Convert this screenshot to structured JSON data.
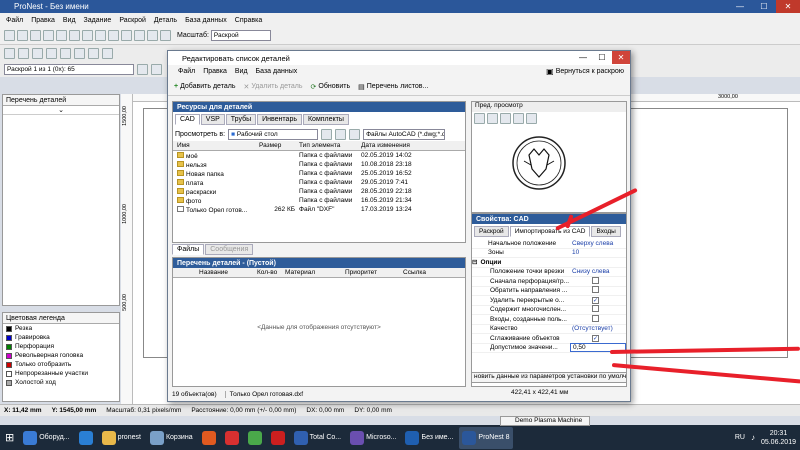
{
  "app": {
    "title": "ProNest - Без имени",
    "menu": [
      "Файл",
      "Правка",
      "Вид",
      "Задание",
      "Раскрой",
      "Деталь",
      "База данных",
      "Справка"
    ],
    "zoom_label": "Масштаб:",
    "zoom_value": "Раскрой",
    "nest_selector": "Раскрой 1 из 1 (0x): 65"
  },
  "left_panel": {
    "title": "Перечень деталей",
    "legend_title": "Цветовая легенда",
    "legend": [
      {
        "label": "Резка",
        "color": "#000000"
      },
      {
        "label": "Гравировка",
        "color": "#0000cc"
      },
      {
        "label": "Перфорация",
        "color": "#008000"
      },
      {
        "label": "Револьверная головка",
        "color": "#cc00cc"
      },
      {
        "label": "Только отобразить",
        "color": "#cc0000"
      },
      {
        "label": "Непрорезанные участки",
        "color": "#ffffff"
      },
      {
        "label": "Холостой ход",
        "color": "#aaaaaa"
      }
    ]
  },
  "rulers": {
    "v1": "1500,00",
    "v2": "1000,00",
    "v3": "500,00",
    "h": "3000,00"
  },
  "dialog": {
    "title": "Редактировать список деталей",
    "menu": [
      "Файл",
      "Правка",
      "Вид",
      "База данных"
    ],
    "return_label": "Вернуться к раскрою",
    "tools": {
      "add": "Добавить деталь",
      "delete": "Удалить деталь",
      "refresh": "Обновить",
      "sheets": "Перечень листов..."
    },
    "resources_title": "Ресурсы для деталей",
    "resource_tabs": [
      "CAD",
      "VSP",
      "Трубы",
      "Инвентарь",
      "Комплекты"
    ],
    "browse_label": "Просмотреть в:",
    "browse_value": "Рабочий стол",
    "filter_value": "Файлы AutoCAD (*.dwg;*.d",
    "file_cols": [
      "Имя",
      "Размер",
      "Тип элемента",
      "Дата изменения"
    ],
    "files": [
      {
        "name": "моё",
        "size": "",
        "type": "Папка с файлами",
        "date": "02.05.2019 14:02",
        "folder": true
      },
      {
        "name": "нельзя",
        "size": "",
        "type": "Папка с файлами",
        "date": "10.08.2018 23:18",
        "folder": true
      },
      {
        "name": "Новая папка",
        "size": "",
        "type": "Папка с файлами",
        "date": "25.05.2019 16:52",
        "folder": true
      },
      {
        "name": "плата",
        "size": "",
        "type": "Папка с файлами",
        "date": "29.05.2019 7:41",
        "folder": true
      },
      {
        "name": "раскраски",
        "size": "",
        "type": "Папка с файлами",
        "date": "28.05.2019 22:18",
        "folder": true
      },
      {
        "name": "фото",
        "size": "",
        "type": "Папка с файлами",
        "date": "16.05.2019 21:34",
        "folder": true
      },
      {
        "name": "Только Орел  готов...",
        "size": "262 КБ",
        "type": "Файл \"DXF\"",
        "date": "17.03.2019 13:24",
        "folder": false
      }
    ],
    "bottom_tabs": [
      "Файлы",
      "Сообщения"
    ],
    "parts_title": "Перечень деталей  -  (Пустой)",
    "parts_cols": [
      "Название",
      "Кол-во",
      "Материал",
      "Приоритет",
      "Ссылка"
    ],
    "parts_empty": "<Данные для отображения отсутствуют>",
    "status_count": "19 объекта(ов)",
    "status_file": "Только Орел готовая.dxf",
    "status_size": "422,41 x 422,41 мм",
    "preview_title": "Пред. просмотр",
    "props_title": "Свойства: CAD",
    "props_tabs": [
      "Раскрой",
      "Импортировать из CAD",
      "Входы"
    ],
    "props": [
      {
        "name": "Начальное положение",
        "value": "Сверху слева",
        "type": "text",
        "indent": false
      },
      {
        "name": "Зоны",
        "value": "10",
        "type": "text",
        "indent": false
      },
      {
        "name": "Опции",
        "value": "",
        "type": "group",
        "indent": false
      },
      {
        "name": "Положение точки врезки",
        "value": "Снизу слева",
        "type": "text",
        "indent": true
      },
      {
        "name": "Сначала перфорация/гр...",
        "value": "",
        "type": "cb",
        "checked": false,
        "indent": true
      },
      {
        "name": "Обратить направления ...",
        "value": "",
        "type": "cb",
        "checked": false,
        "indent": true
      },
      {
        "name": "Удалить перекрытые о...",
        "value": "",
        "type": "cb",
        "checked": true,
        "indent": true
      },
      {
        "name": "Содержит многочислен...",
        "value": "",
        "type": "cb",
        "checked": false,
        "indent": true
      },
      {
        "name": "Входы, созданные поль...",
        "value": "",
        "type": "cb",
        "checked": false,
        "indent": true
      },
      {
        "name": "Качество",
        "value": "(Отсутствует)",
        "type": "text",
        "indent": true
      },
      {
        "name": "Сглаживание объектов",
        "value": "",
        "type": "cb",
        "checked": true,
        "indent": true
      },
      {
        "name": "Допустимое значени...",
        "value": "0,50",
        "type": "text",
        "indent": true
      }
    ],
    "props_footer": "новить данные из параметров установки по умолч"
  },
  "status": {
    "x": "X: 11,42 mm",
    "y": "Y: 1545,00 mm",
    "scale": "Масштаб: 0,31 pixels/mm",
    "dist": "Расстояние: 0,00 mm (+/- 0,00 mm)",
    "dx": "DX: 0,00 mm",
    "dy": "DY: 0,00 mm"
  },
  "taskbar": {
    "items": [
      {
        "label": "Оборуд...",
        "color": "#3a7bd5"
      },
      {
        "label": "",
        "color": "#2a7fd4"
      },
      {
        "label": "pronest",
        "color": "#e8b84a"
      },
      {
        "label": "Корзина",
        "color": "#7aa0c8"
      },
      {
        "label": "",
        "color": "#e05a20"
      },
      {
        "label": "",
        "color": "#d83030"
      },
      {
        "label": "",
        "color": "#4aa84a"
      },
      {
        "label": "",
        "color": "#cc1f1f"
      },
      {
        "label": "Total Co...",
        "color": "#3060b0"
      },
      {
        "label": "Microso...",
        "color": "#6a4fb0"
      },
      {
        "label": "Без име...",
        "color": "#1f5fb0"
      },
      {
        "label": "ProNest 8",
        "color": "#2b579a"
      }
    ],
    "popup": "Demo Plasma Machine",
    "lang": "RU",
    "time": "20:31",
    "date": "05.06.2019"
  },
  "colors": {
    "accent": "#2e5c9a",
    "arrow": "#e8202a"
  }
}
